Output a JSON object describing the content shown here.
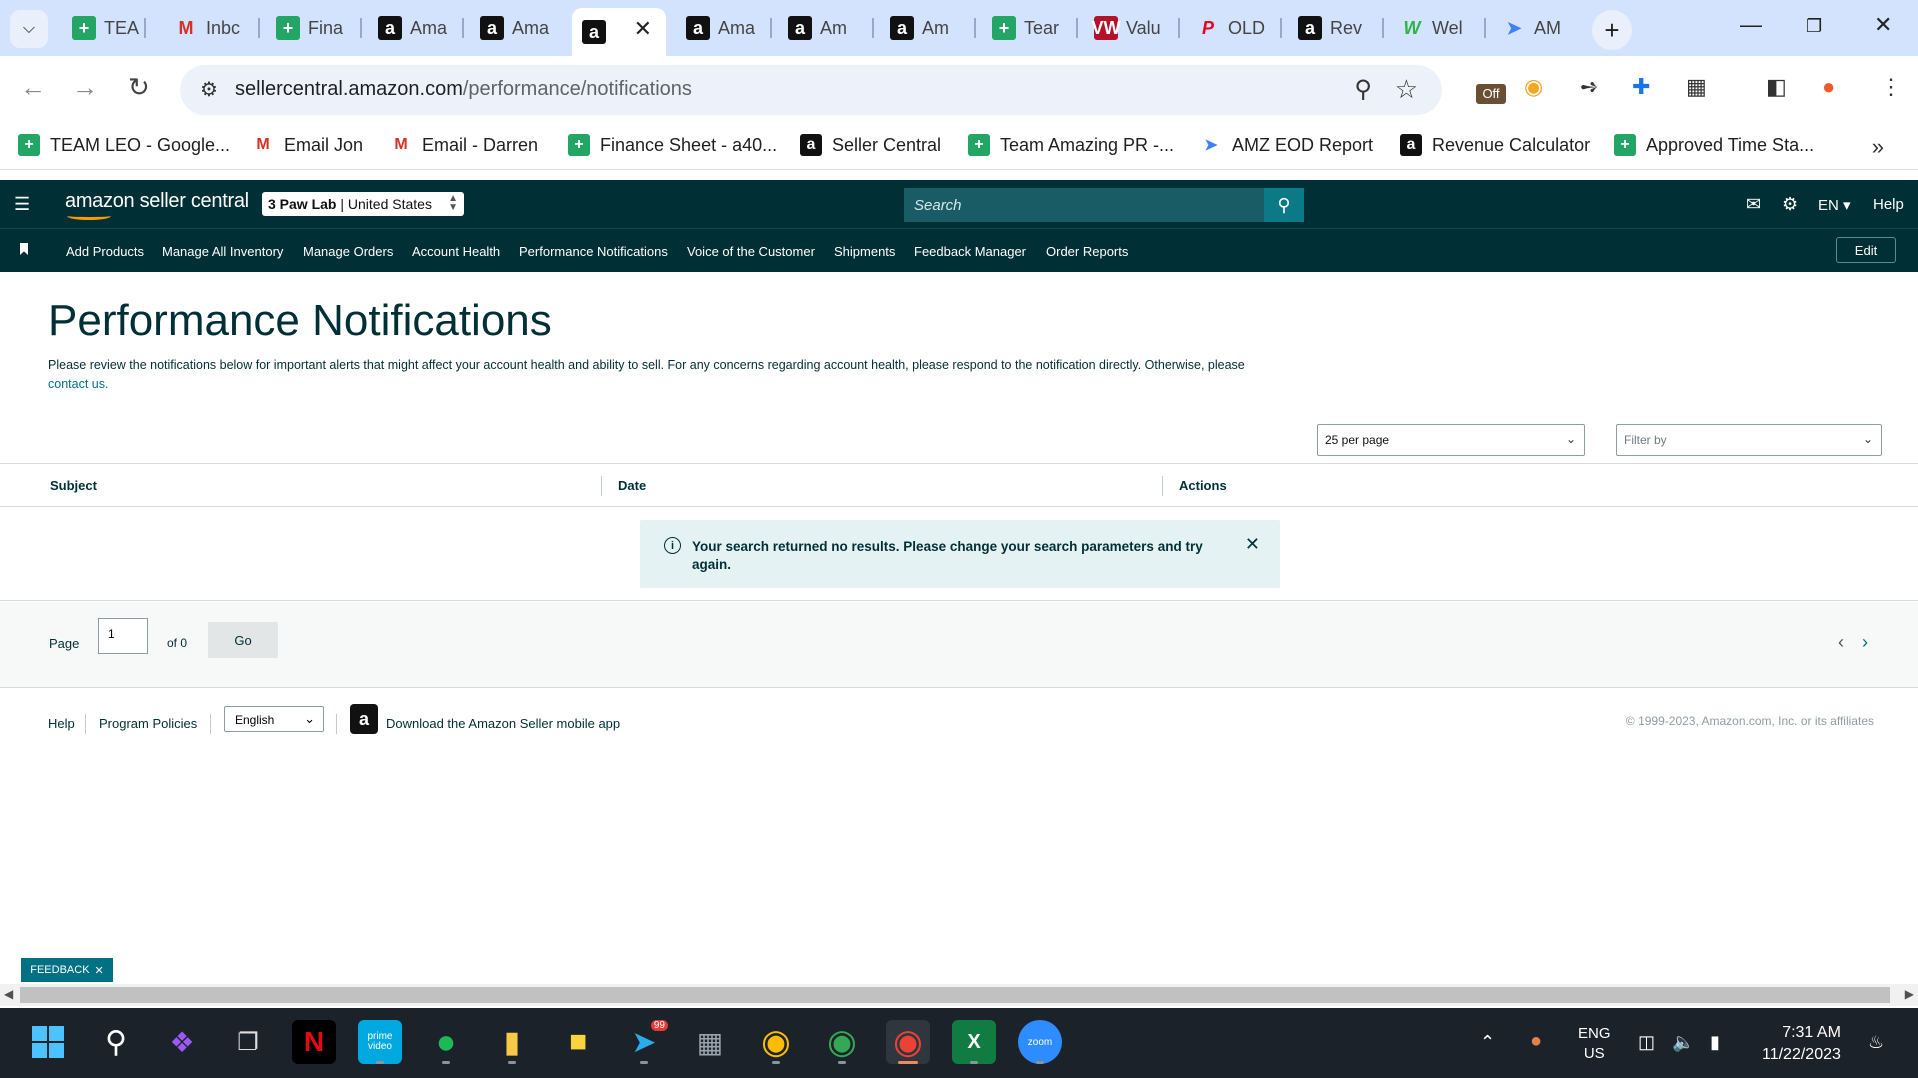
{
  "browser": {
    "tabs": [
      {
        "label": "TEA",
        "icon": "sheets-icon"
      },
      {
        "label": "Inbc",
        "icon": "gmail-icon"
      },
      {
        "label": "Fina",
        "icon": "sheets-icon"
      },
      {
        "label": "Ama",
        "icon": "amazon-icon"
      },
      {
        "label": "Ama",
        "icon": "amazon-icon"
      },
      {
        "label": "",
        "icon": "amazon-icon",
        "active": true
      },
      {
        "label": "Ama",
        "icon": "amazon-icon"
      },
      {
        "label": "Am",
        "icon": "amazon-icon"
      },
      {
        "label": "Am",
        "icon": "amazon-icon"
      },
      {
        "label": "Tear",
        "icon": "sheets-icon"
      },
      {
        "label": "Valu",
        "icon": "vw-icon"
      },
      {
        "label": "OLD",
        "icon": "pinterest-icon"
      },
      {
        "label": "Rev",
        "icon": "amazon-icon"
      },
      {
        "label": "Wel",
        "icon": "w-icon"
      },
      {
        "label": "AM",
        "icon": "arrow-icon"
      }
    ],
    "url_host": "sellercentral.amazon.com",
    "url_path": "/performance/notifications",
    "off_badge": "Off",
    "bookmarks": [
      {
        "label": "TEAM LEO - Google...",
        "icon": "sheets-icon"
      },
      {
        "label": "Email Jon",
        "icon": "gmail-icon"
      },
      {
        "label": "Email - Darren",
        "icon": "gmail-icon"
      },
      {
        "label": "Finance Sheet - a40...",
        "icon": "sheets-icon"
      },
      {
        "label": "Seller Central",
        "icon": "amazon-icon"
      },
      {
        "label": "Team Amazing PR -...",
        "icon": "sheets-icon"
      },
      {
        "label": "AMZ EOD Report",
        "icon": "arrow-icon"
      },
      {
        "label": "Revenue Calculator",
        "icon": "amazon-icon"
      },
      {
        "label": "Approved Time Sta...",
        "icon": "sheets-icon"
      }
    ]
  },
  "seller_central": {
    "logo": "amazon seller central",
    "account_name": "3 Paw Lab",
    "account_region": "United States",
    "search_placeholder": "Search",
    "language": "EN",
    "help": "Help",
    "nav_links": [
      "Add Products",
      "Manage All Inventory",
      "Manage Orders",
      "Account Health",
      "Performance Notifications",
      "Voice of the Customer",
      "Shipments",
      "Feedback Manager",
      "Order Reports"
    ],
    "edit": "Edit"
  },
  "page": {
    "title": "Performance Notifications",
    "description": "Please review the notifications below for important alerts that might affect your account health and ability to sell. For any concerns regarding account health, please respond to the notification directly. Otherwise, please",
    "contact_link": "contact us.",
    "per_page": "25 per page",
    "filter_placeholder": "Filter by",
    "columns": [
      "Subject",
      "Date",
      "Actions"
    ],
    "alert_message": "Your search returned no results. Please change your search parameters and try again.",
    "pager": {
      "page_label": "Page",
      "page_value": "1",
      "of_label": "of 0",
      "go": "Go"
    }
  },
  "footer": {
    "help": "Help",
    "program_policies": "Program Policies",
    "language": "English",
    "app_link": "Download the Amazon Seller mobile app",
    "copyright": "© 1999-2023, Amazon.com, Inc. or its affiliates",
    "feedback": "FEEDBACK"
  },
  "taskbar": {
    "apps": [
      "windows-start",
      "search",
      "copilot",
      "task-view",
      "netflix",
      "prime-video",
      "spotify",
      "file-explorer",
      "sticky-notes",
      "telegram",
      "calculator",
      "chrome",
      "chrome",
      "chrome",
      "excel",
      "zoom"
    ],
    "telegram_badge": "99",
    "lang_line1": "ENG",
    "lang_line2": "US",
    "time": "7:31 AM",
    "date": "11/22/2023"
  },
  "colors": {
    "sc_header": "#002f36",
    "sc_search_btn": "#0c7a86",
    "link": "#007185",
    "alert_bg": "#e5f2f3"
  }
}
